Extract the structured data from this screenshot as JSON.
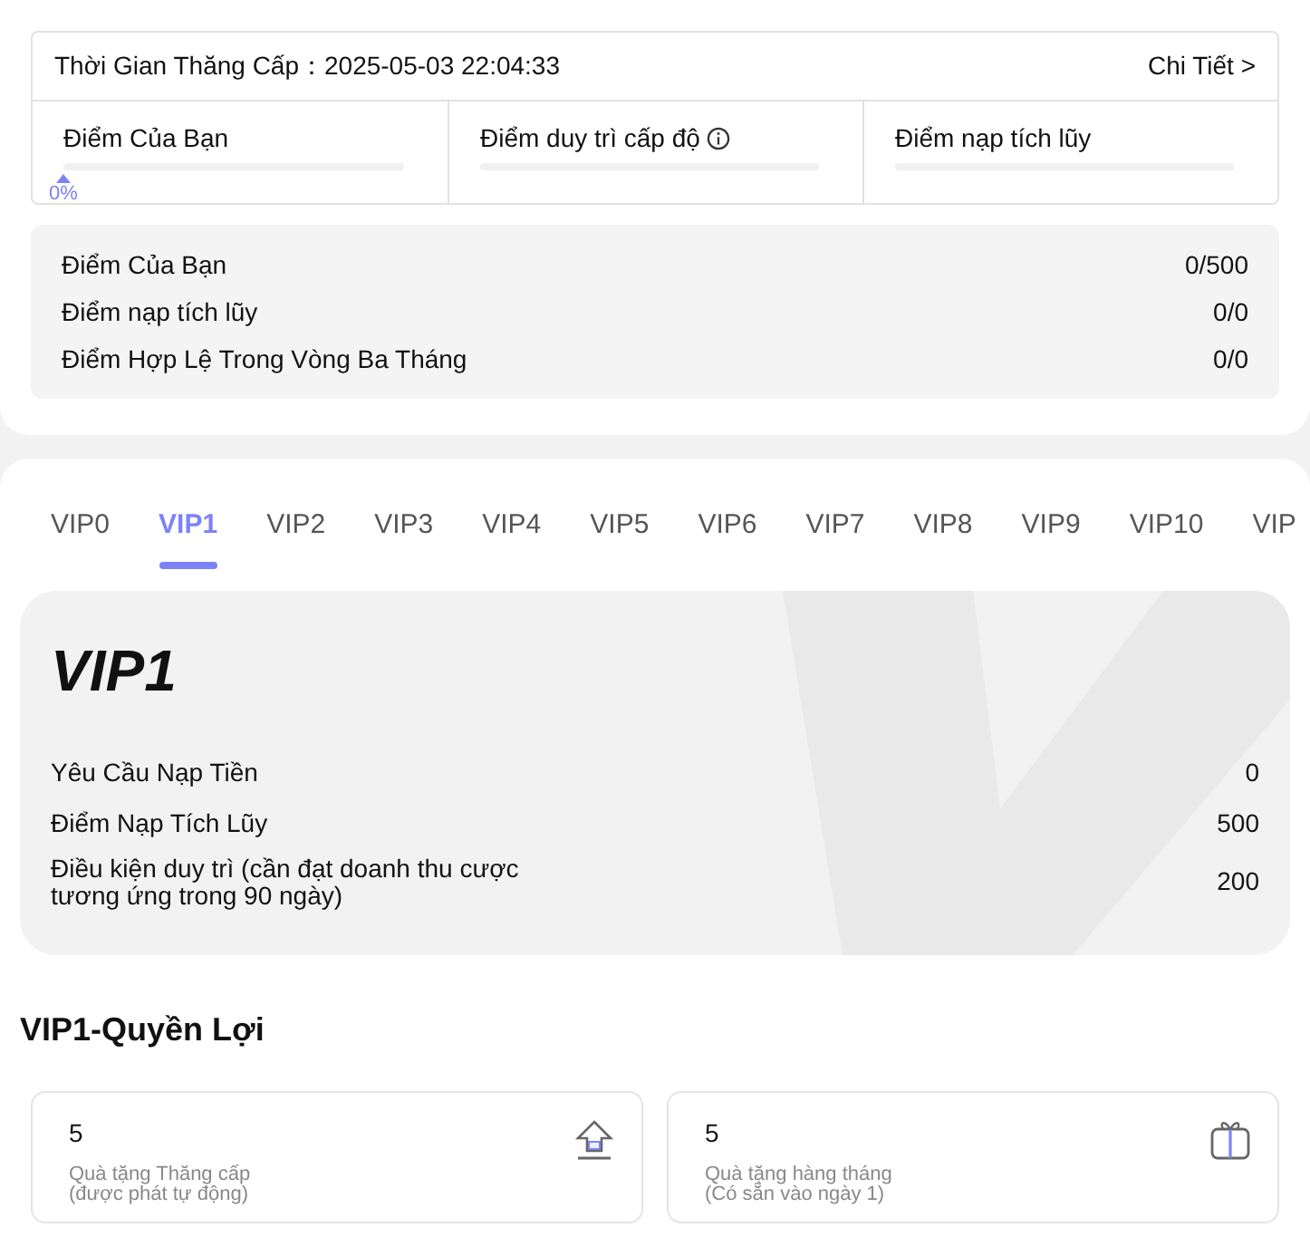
{
  "upgrade": {
    "label": "Thời Gian Thăng Cấp：",
    "time": "2025-05-03 22:04:33",
    "detail_link": "Chi Tiết >"
  },
  "progress": [
    {
      "label": "Điểm Của Bạn",
      "level": 0,
      "reading": "0%",
      "kind": "plain"
    },
    {
      "label": "Điểm duy trì cấp độ",
      "kind": "info"
    },
    {
      "label": "Điểm nạp tích lũy",
      "kind": "plain"
    }
  ],
  "summary": [
    {
      "label": "Điểm Của Bạn",
      "value": "0/500"
    },
    {
      "label": "Điểm nạp tích lũy",
      "value": "0/0"
    },
    {
      "label": "Điểm Hợp Lệ Trong Vòng Ba Tháng",
      "value": "0/0"
    }
  ],
  "tabs": [
    {
      "label": "VIP0",
      "selected": false
    },
    {
      "label": "VIP1",
      "selected": true
    },
    {
      "label": "VIP2",
      "selected": false
    },
    {
      "label": "VIP3",
      "selected": false
    },
    {
      "label": "VIP4",
      "selected": false
    },
    {
      "label": "VIP5",
      "selected": false
    },
    {
      "label": "VIP6",
      "selected": false
    },
    {
      "label": "VIP7",
      "selected": false
    },
    {
      "label": "VIP8",
      "selected": false
    },
    {
      "label": "VIP9",
      "selected": false
    },
    {
      "label": "VIP10",
      "selected": false
    },
    {
      "label": "VIP",
      "selected": false
    }
  ],
  "vip_card": {
    "title": "VIP1",
    "rows": [
      {
        "label": "Yêu Cầu Nạp Tiền",
        "value": "0"
      },
      {
        "label": "Điểm Nạp Tích Lũy",
        "value": "500"
      },
      {
        "label": "Điều kiện duy trì (cần đạt doanh thu cược tương ứng trong 90 ngày)",
        "value": "200"
      }
    ]
  },
  "benefits": {
    "title": "VIP1-Quyền Lợi",
    "items": [
      {
        "kind": "upgrade",
        "value": "5",
        "line1": "Quà tặng Thăng cấp",
        "line2": "(được phát tự động)"
      },
      {
        "kind": "monthly",
        "value": "5",
        "line1": "Quà tặng hàng tháng",
        "line2": "(Có sẵn vào ngày 1)"
      }
    ]
  }
}
